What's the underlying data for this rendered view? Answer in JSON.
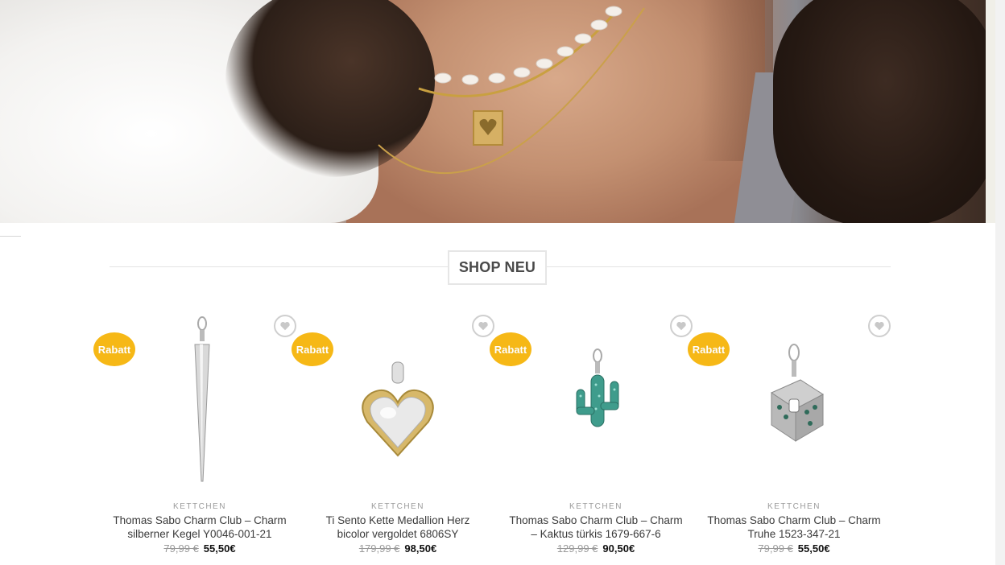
{
  "section": {
    "title": "SHOP NEU"
  },
  "products": [
    {
      "badge": "Rabatt",
      "category": "KETTCHEN",
      "name_line1": "Thomas Sabo Charm Club – Charm",
      "name_line2": "silberner Kegel Y0046-001-21",
      "old_price": "79,99 €",
      "new_price": "55,50€",
      "icon": "cone-charm"
    },
    {
      "badge": "Rabatt",
      "category": "KETTCHEN",
      "name_line1": "Ti Sento Kette Medallion Herz",
      "name_line2": "bicolor vergoldet 6806SY",
      "old_price": "179,99 €",
      "new_price": "98,50€",
      "icon": "heart-pendant"
    },
    {
      "badge": "Rabatt",
      "category": "KETTCHEN",
      "name_line1": "Thomas Sabo Charm Club – Charm",
      "name_line2": "– Kaktus türkis 1679-667-6",
      "old_price": "129,99 €",
      "new_price": "90,50€",
      "icon": "cactus-charm"
    },
    {
      "badge": "Rabatt",
      "category": "KETTCHEN",
      "name_line1": "Thomas Sabo Charm Club – Charm",
      "name_line2": "Truhe 1523-347-21",
      "old_price": "79,99 €",
      "new_price": "55,50€",
      "icon": "chest-charm"
    }
  ],
  "colors": {
    "badge": "#f6b816",
    "accent_text": "#4a4a4a"
  }
}
